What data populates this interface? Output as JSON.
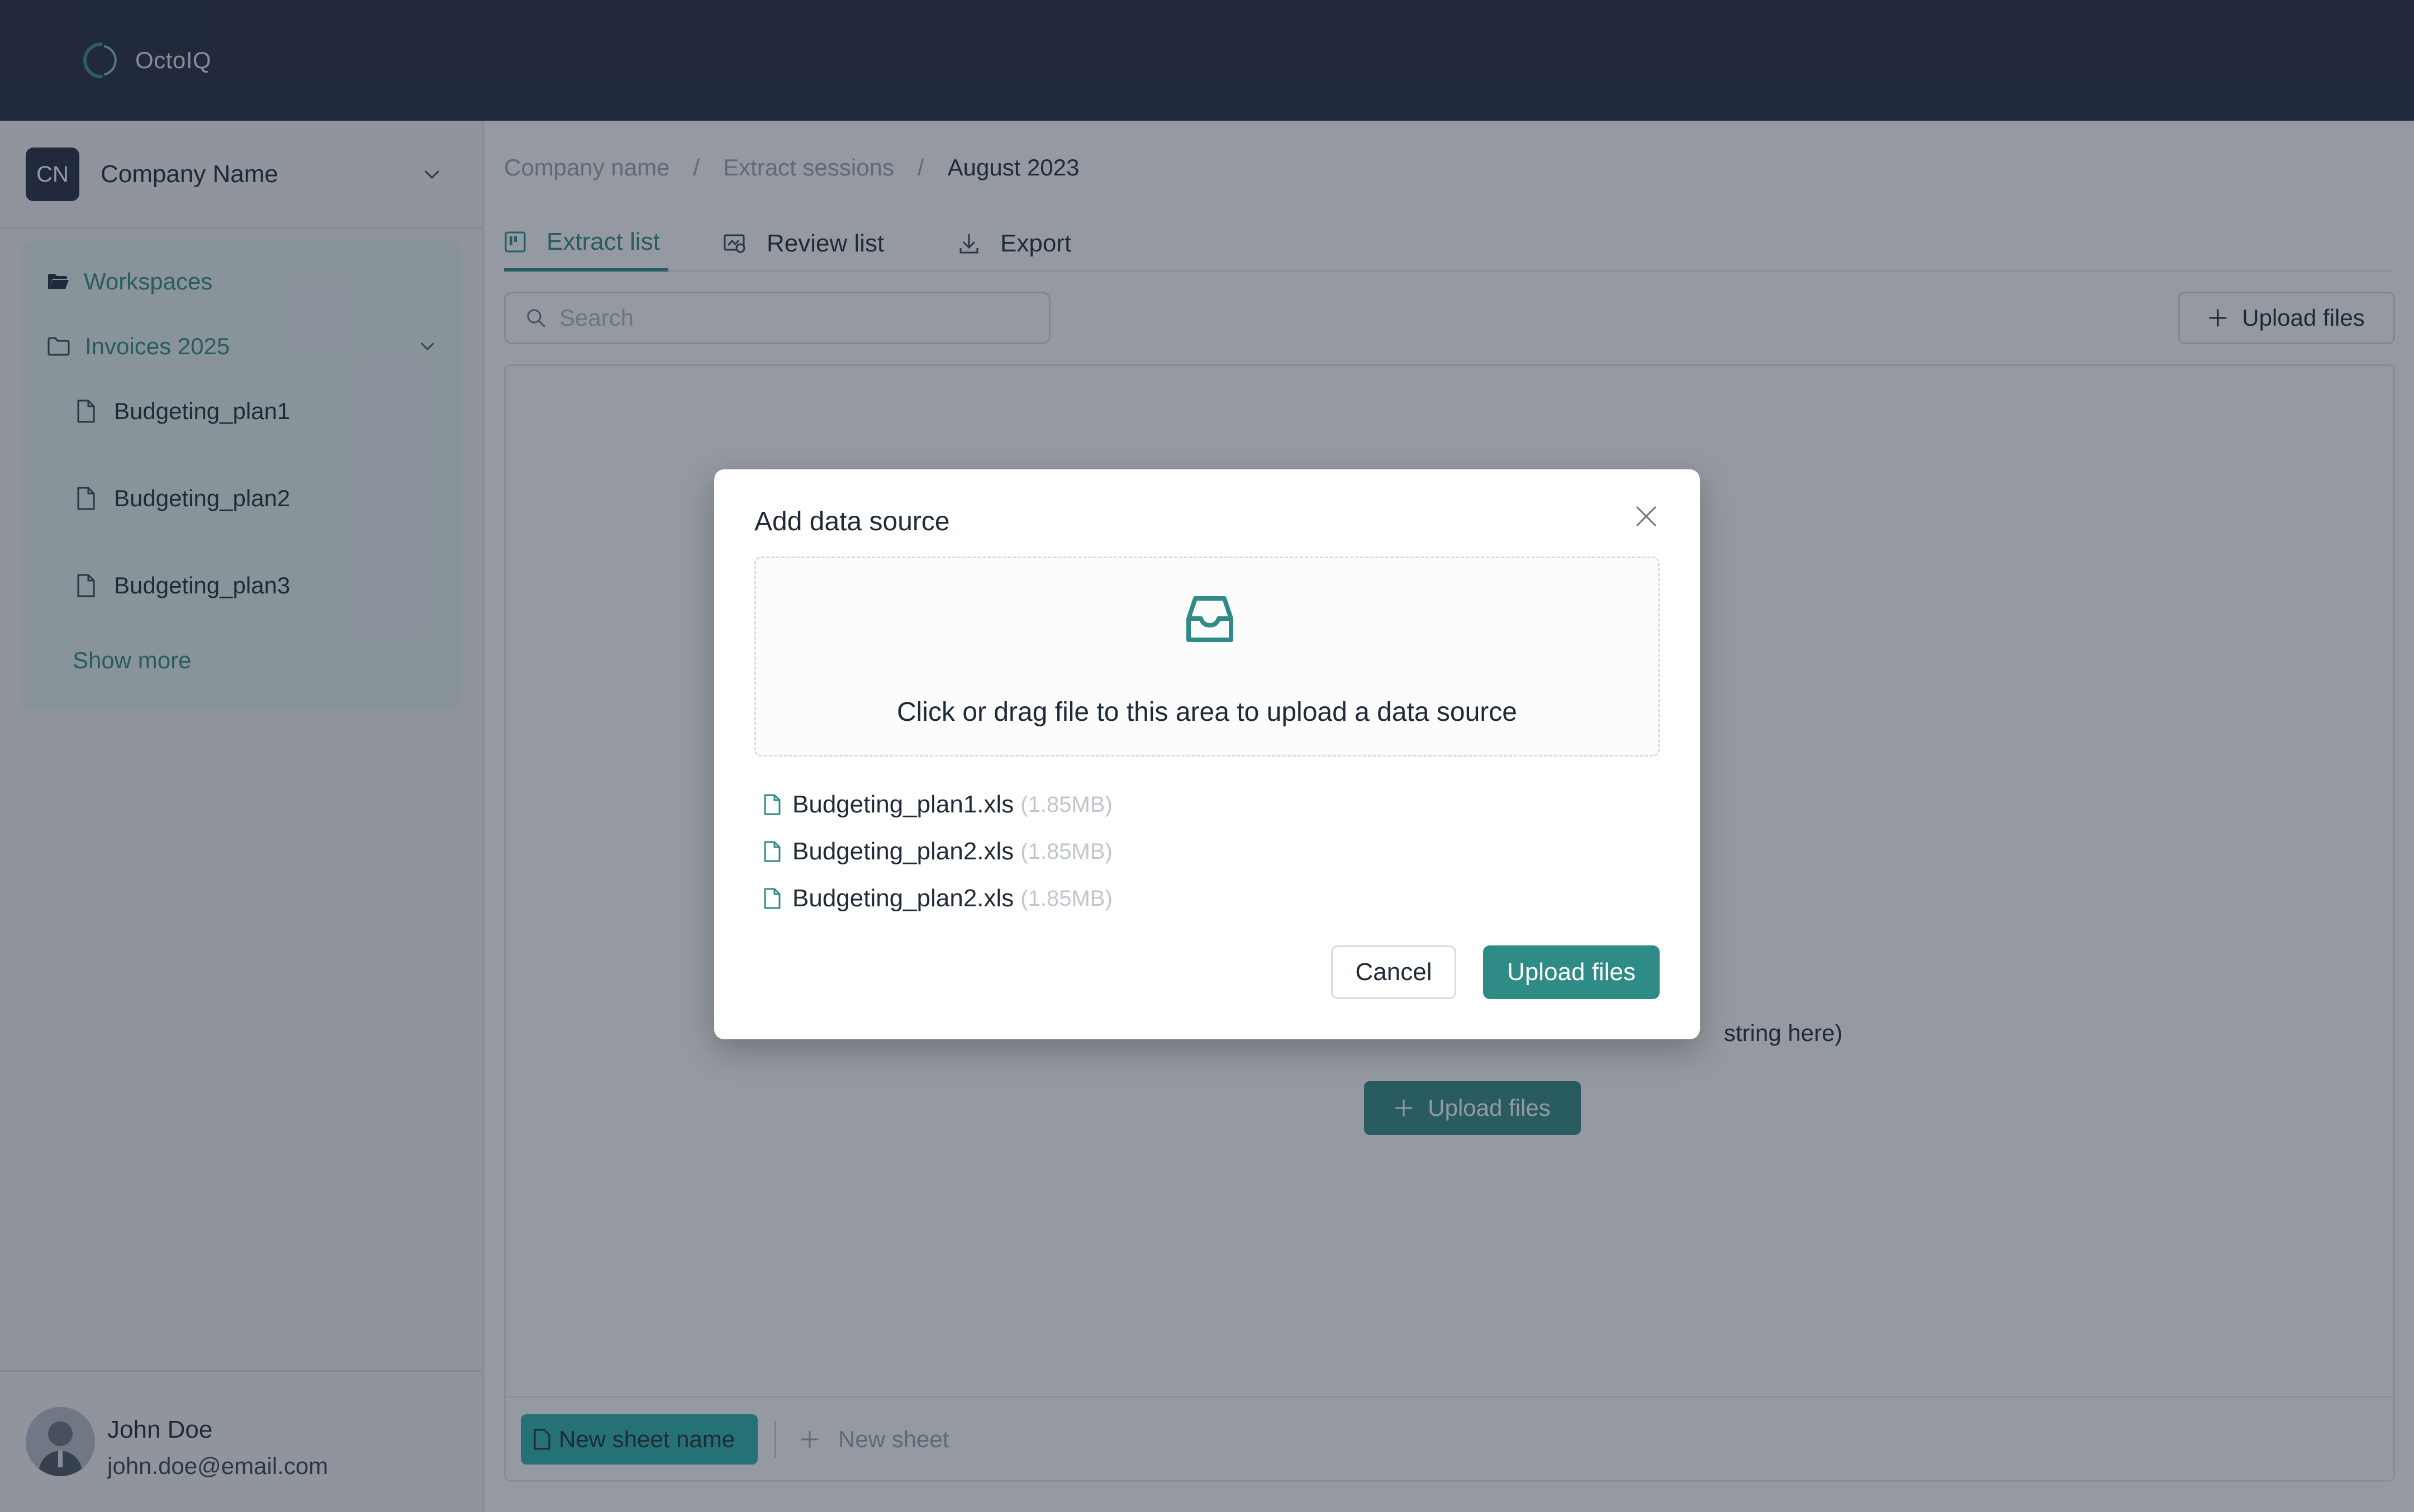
{
  "app": {
    "name": "OctoIQ"
  },
  "company": {
    "initials": "CN",
    "name": "Company Name"
  },
  "sidebar": {
    "workspaces_label": "Workspaces",
    "folder_label": "Invoices 2025",
    "files": [
      "Budgeting_plan1",
      "Budgeting_plan2",
      "Budgeting_plan3"
    ],
    "show_more": "Show more"
  },
  "user": {
    "name": "John Doe",
    "email": "john.doe@email.com"
  },
  "breadcrumb": {
    "items": [
      "Company name",
      "Extract sessions"
    ],
    "separator": "/",
    "current": "August 2023"
  },
  "tabs": [
    {
      "label": "Extract list",
      "icon": "kanban-icon",
      "active": true
    },
    {
      "label": "Review list",
      "icon": "review-icon",
      "active": false
    },
    {
      "label": "Export",
      "icon": "download-icon",
      "active": false
    }
  ],
  "search": {
    "placeholder": "Search",
    "value": ""
  },
  "toolbar": {
    "upload_label": "Upload files"
  },
  "content": {
    "empty_text_visible": "string here)",
    "upload_label": "Upload files"
  },
  "sheets": {
    "active_label": "New sheet name",
    "new_label": "New sheet"
  },
  "modal": {
    "title": "Add data source",
    "dropzone_text": "Click or drag file to this area to upload a data source",
    "files": [
      {
        "name": "Budgeting_plan1.xls",
        "size": "(1.85MB)"
      },
      {
        "name": "Budgeting_plan2.xls",
        "size": "(1.85MB)"
      },
      {
        "name": "Budgeting_plan2.xls",
        "size": "(1.85MB)"
      }
    ],
    "cancel_label": "Cancel",
    "upload_label": "Upload files"
  },
  "colors": {
    "accent": "#2f8b85",
    "topbar": "#22293e",
    "sheet_active": "#2ab5ad"
  }
}
